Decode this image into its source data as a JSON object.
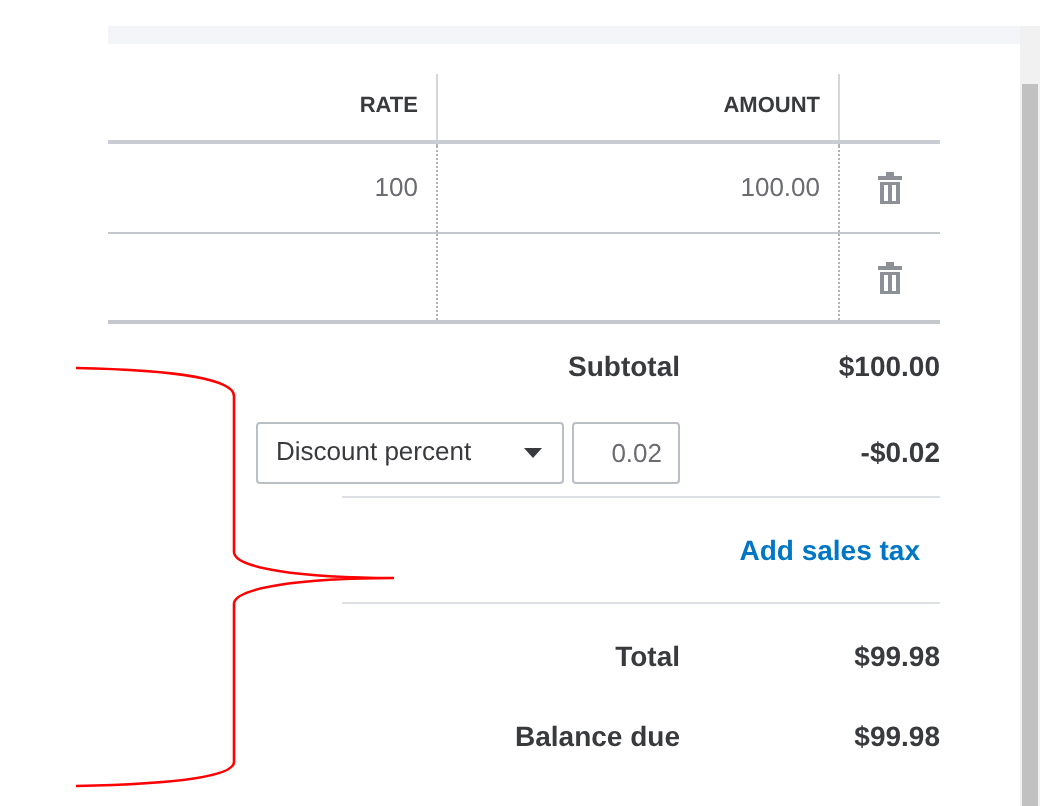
{
  "table": {
    "columns": [
      {
        "label": "RATE"
      },
      {
        "label": "AMOUNT"
      }
    ],
    "rows": [
      {
        "rate": "100",
        "amount": "100.00"
      },
      {}
    ]
  },
  "totals": {
    "subtotal": {
      "label": "Subtotal",
      "value": "$100.00"
    },
    "discount": {
      "type": "Discount percent",
      "value": "0.02",
      "amount": "-$0.02"
    },
    "add_tax_link": "Add sales tax",
    "total": {
      "label": "Total",
      "value": "$99.98"
    },
    "balance_due": {
      "label": "Balance due",
      "value": "$99.98"
    }
  }
}
